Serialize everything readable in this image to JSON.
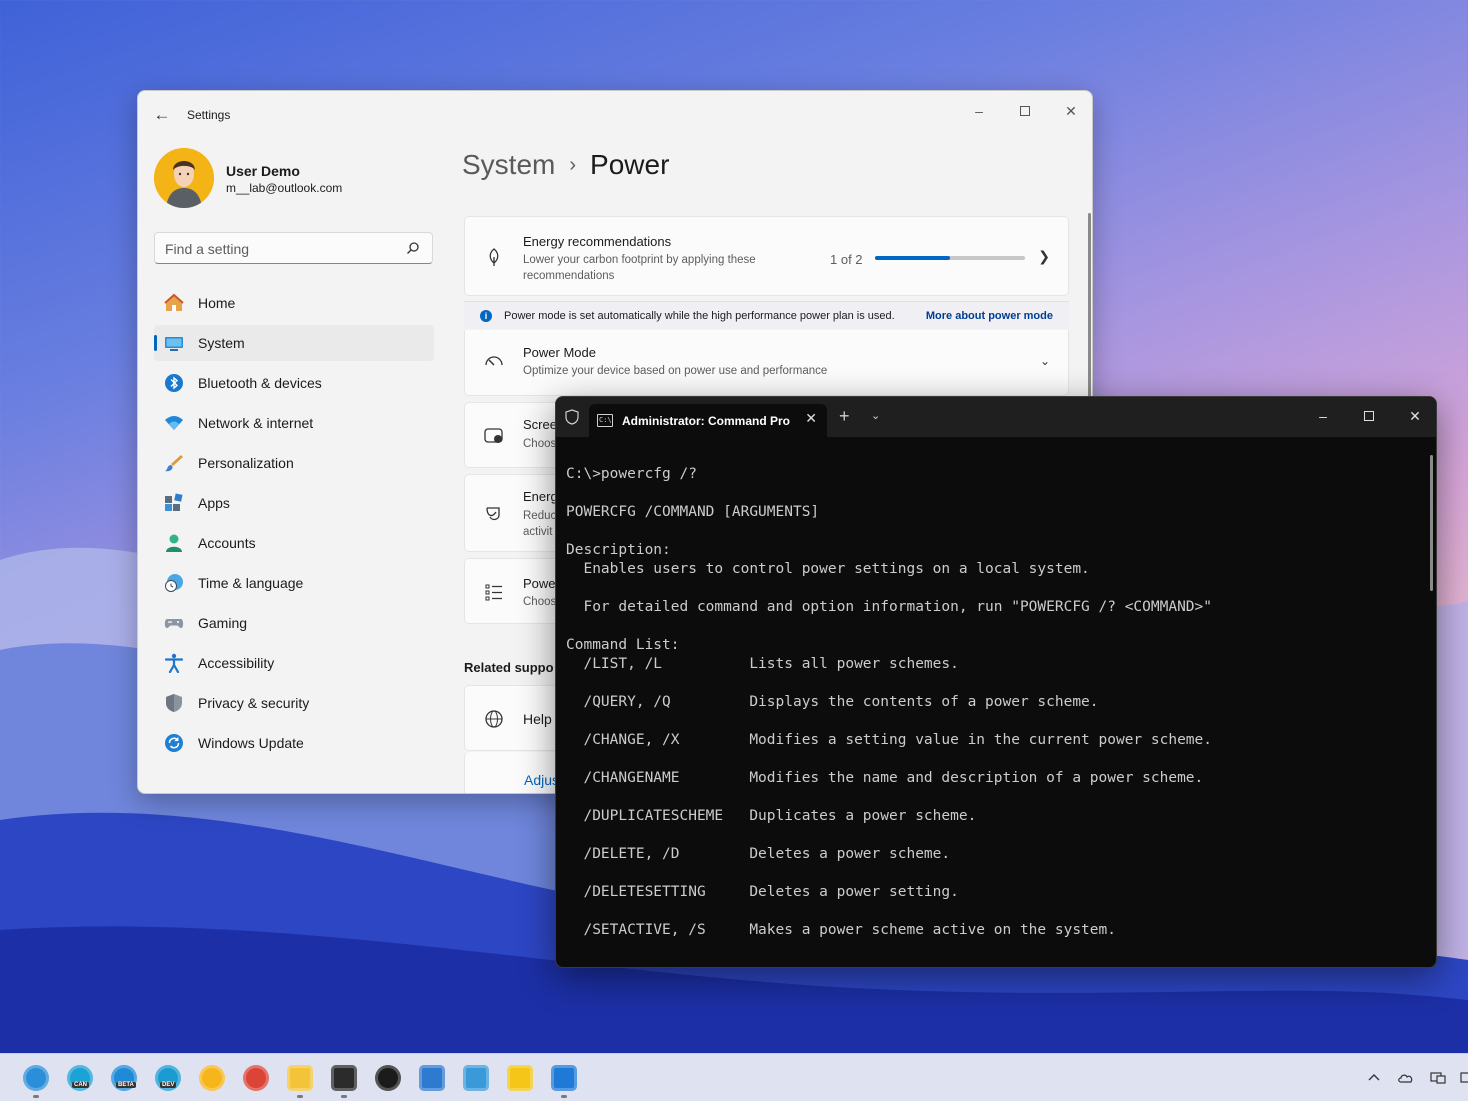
{
  "settings": {
    "window_title": "Settings",
    "user": {
      "name": "User Demo",
      "email": "m__lab@outlook.com"
    },
    "search": {
      "placeholder": "Find a setting"
    },
    "nav": [
      {
        "label": "Home",
        "icon": "home-icon"
      },
      {
        "label": "System",
        "icon": "system-icon",
        "selected": true
      },
      {
        "label": "Bluetooth & devices",
        "icon": "bluetooth-icon"
      },
      {
        "label": "Network & internet",
        "icon": "wifi-icon"
      },
      {
        "label": "Personalization",
        "icon": "brush-icon"
      },
      {
        "label": "Apps",
        "icon": "apps-icon"
      },
      {
        "label": "Accounts",
        "icon": "accounts-icon"
      },
      {
        "label": "Time & language",
        "icon": "time-language-icon"
      },
      {
        "label": "Gaming",
        "icon": "gamepad-icon"
      },
      {
        "label": "Accessibility",
        "icon": "accessibility-icon"
      },
      {
        "label": "Privacy & security",
        "icon": "shield-icon"
      },
      {
        "label": "Windows Update",
        "icon": "update-icon"
      }
    ],
    "breadcrumb": {
      "parent": "System",
      "current": "Power"
    },
    "energy_recommendations": {
      "title": "Energy recommendations",
      "subtitle": "Lower your carbon footprint by applying these recommendations",
      "progress_text": "1 of 2",
      "progress_fraction": 0.5
    },
    "info_bar": {
      "text": "Power mode is set automatically while the high performance power plan is used.",
      "link": "More about power mode"
    },
    "power_mode": {
      "title": "Power Mode",
      "subtitle": "Optimize your device based on power use and performance"
    },
    "partial_cards": [
      {
        "title": "Scree",
        "subtitle": "Choos"
      },
      {
        "title": "Energ",
        "subtitle": "Reduc\nactivit"
      },
      {
        "title": "Powe",
        "subtitle": "Choos"
      }
    ],
    "related_support": "Related suppo",
    "help_card": {
      "title": "Help"
    },
    "adjust_link": "Adjus"
  },
  "terminal": {
    "tab_title": "Administrator: Command Pro",
    "lines": [
      "C:\\>powercfg /?",
      "",
      "POWERCFG /COMMAND [ARGUMENTS]",
      "",
      "Description:",
      "  Enables users to control power settings on a local system.",
      "",
      "  For detailed command and option information, run \"POWERCFG /? <COMMAND>\"",
      "",
      "Command List:",
      "  /LIST, /L          Lists all power schemes.",
      "",
      "  /QUERY, /Q         Displays the contents of a power scheme.",
      "",
      "  /CHANGE, /X        Modifies a setting value in the current power scheme.",
      "",
      "  /CHANGENAME        Modifies the name and description of a power scheme.",
      "",
      "  /DUPLICATESCHEME   Duplicates a power scheme.",
      "",
      "  /DELETE, /D        Deletes a power scheme.",
      "",
      "  /DELETESETTING     Deletes a power setting.",
      "",
      "  /SETACTIVE, /S     Makes a power scheme active on the system."
    ]
  },
  "taskbar": {
    "apps": [
      {
        "name": "edge-canary-icon",
        "label": "",
        "color": "#2a8fd8",
        "running": true
      },
      {
        "name": "edge-can-icon",
        "label": "CAN",
        "color": "#1ca2d4",
        "running": false
      },
      {
        "name": "edge-beta-icon",
        "label": "BETA",
        "color": "#1f8ad6",
        "running": false
      },
      {
        "name": "edge-dev-icon",
        "label": "DEV",
        "color": "#1a9bd1",
        "running": false
      },
      {
        "name": "chrome-canary-icon",
        "label": "",
        "color": "#f7b51c",
        "running": false
      },
      {
        "name": "chrome-icon",
        "label": "",
        "color": "#db4437",
        "running": false
      },
      {
        "name": "file-explorer-icon",
        "label": "",
        "color": "#f3c33a",
        "running": true
      },
      {
        "name": "terminal-icon",
        "label": "",
        "color": "#2b2b2b",
        "running": true
      },
      {
        "name": "chatgpt-icon",
        "label": "",
        "color": "#1b1b1b",
        "running": false
      },
      {
        "name": "notepad-icon",
        "label": "",
        "color": "#2f7ad1",
        "running": false
      },
      {
        "name": "remote-desktop-icon",
        "label": "",
        "color": "#3a9ad9",
        "running": false
      },
      {
        "name": "sticky-notes-icon",
        "label": "",
        "color": "#f5c518",
        "running": false
      },
      {
        "name": "vscode-icon",
        "label": "",
        "color": "#1e7ad6",
        "running": true
      }
    ]
  },
  "colors": {
    "accent": "#0067c0",
    "terminal_bg": "#0c0c0c",
    "terminal_fg": "#cccccc"
  }
}
